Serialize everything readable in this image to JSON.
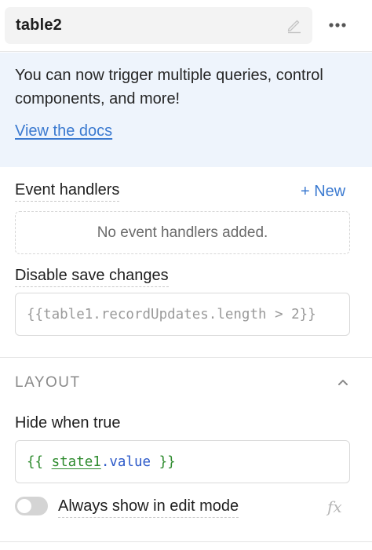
{
  "header": {
    "component_name": "table2",
    "edit_icon": "pencil-icon",
    "more_icon": "ellipsis-icon"
  },
  "banner": {
    "text": "You can now trigger multiple queries, control components, and more!",
    "link_label": "View the docs",
    "background_color": "#eef4fc",
    "link_color": "#3b7ad0"
  },
  "event_handlers": {
    "label": "Event handlers",
    "new_label": "+ New",
    "empty_text": "No event handlers added."
  },
  "disable_save": {
    "label": "Disable save changes",
    "placeholder": "{{table1.recordUpdates.length > 2}}"
  },
  "layout": {
    "title": "LAYOUT",
    "collapse_icon": "chevron-up-icon",
    "hide_when_true": {
      "label": "Hide when true",
      "value_open": "{{ ",
      "value_token": "state1",
      "value_prop": ".value",
      "value_close": " }}"
    },
    "always_show": {
      "label": "Always show in edit mode",
      "enabled": false,
      "fx_label": "fx"
    }
  },
  "colors": {
    "code_green": "#2e8b2e",
    "code_blue": "#2d5ac9",
    "accent": "#3b7ad0"
  }
}
